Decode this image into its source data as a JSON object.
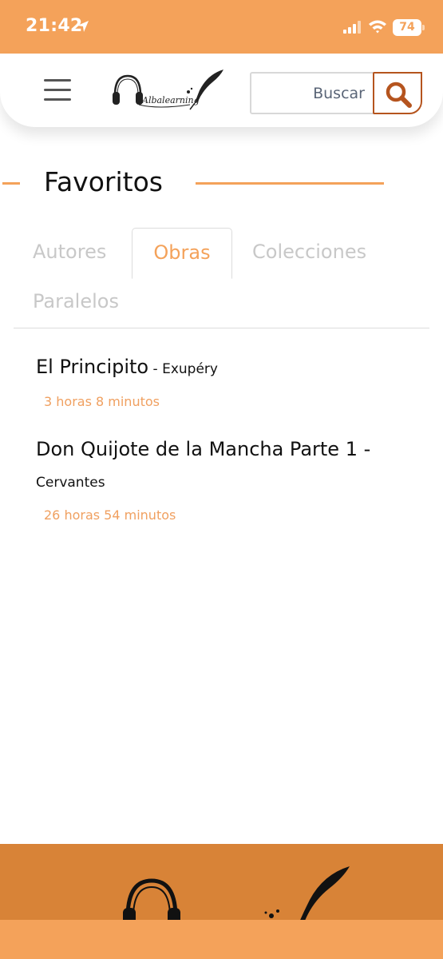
{
  "status_bar": {
    "time": "21:42",
    "battery": "74"
  },
  "header": {
    "logo_text": "Albalearning",
    "search": {
      "placeholder": "Buscar",
      "value": ""
    }
  },
  "page": {
    "title": "Favoritos"
  },
  "tabs": [
    {
      "label": "Autores",
      "active": false
    },
    {
      "label": "Obras",
      "active": true
    },
    {
      "label": "Colecciones",
      "active": false
    },
    {
      "label": "Paralelos",
      "active": false
    }
  ],
  "items": [
    {
      "title": "El Principito",
      "separator": " - ",
      "author": "Exupéry",
      "duration": "3 horas 8 minutos"
    },
    {
      "title": "Don Quijote de la Mancha Parte 1",
      "separator": " -",
      "author": "Cervantes",
      "duration": "26 horas 54 minutos"
    }
  ],
  "colors": {
    "accent": "#f4a25a",
    "footer": "#d88337",
    "search_border": "#b5541e",
    "inactive_tab": "#c8c8c8"
  },
  "icons": [
    "location-arrow-icon",
    "signal-icon",
    "wifi-icon",
    "battery-icon",
    "hamburger-menu-icon",
    "search-icon",
    "headphones-icon",
    "feather-quill-icon"
  ]
}
